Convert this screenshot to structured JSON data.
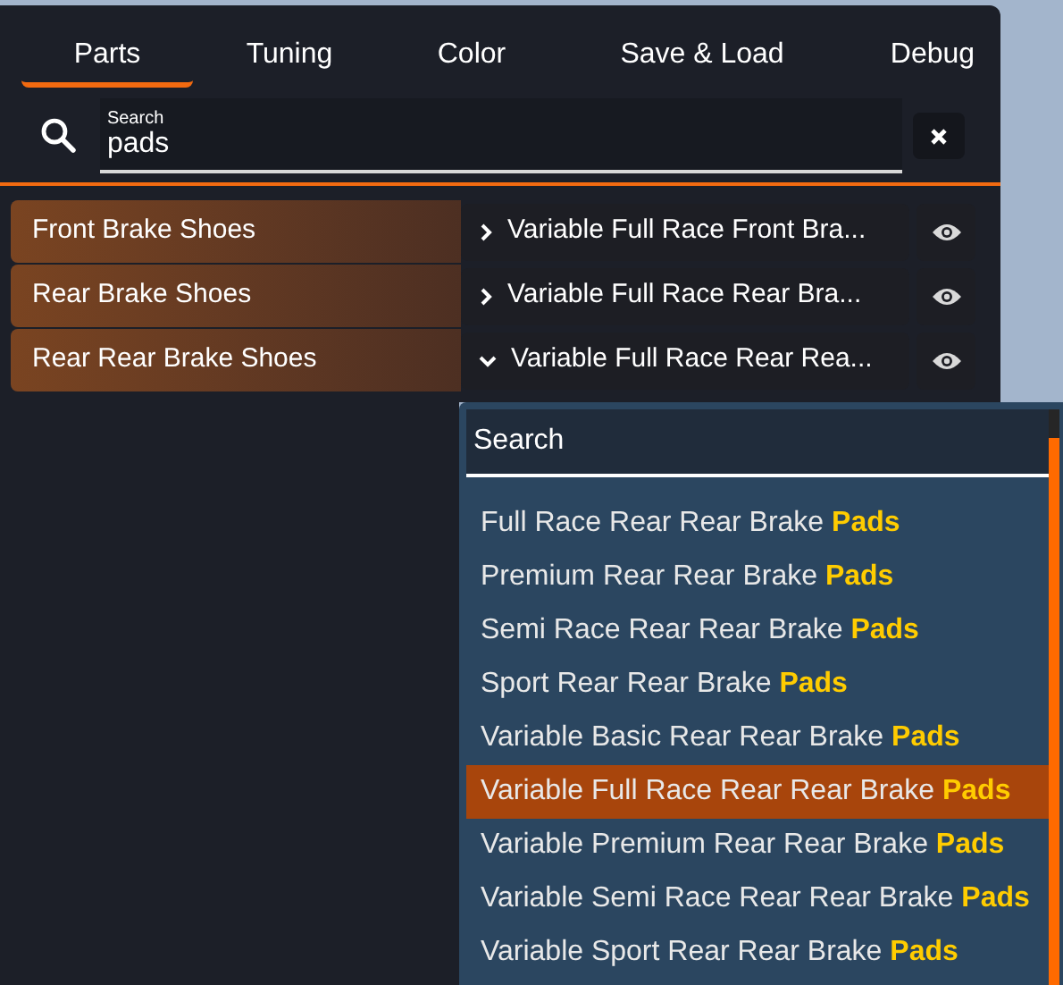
{
  "tabs": [
    {
      "label": "Parts",
      "selected": true
    },
    {
      "label": "Tuning",
      "selected": false
    },
    {
      "label": "Color",
      "selected": false
    },
    {
      "label": "Save & Load",
      "selected": false
    },
    {
      "label": "Debug",
      "selected": false
    }
  ],
  "search": {
    "label": "Search",
    "value": "pads"
  },
  "parts": [
    {
      "slot": "Front Brake Shoes",
      "choice": "Variable Full Race Front Bra...",
      "expanded": false
    },
    {
      "slot": "Rear Brake Shoes",
      "choice": "Variable Full Race Rear Bra...",
      "expanded": false
    },
    {
      "slot": "Rear Rear Brake Shoes",
      "choice": "Variable Full Race Rear Rea...",
      "expanded": true
    }
  ],
  "dropdown": {
    "search_placeholder": "Search",
    "options": [
      {
        "label": "Full Race Rear Rear Brake **Pads**",
        "selected": false
      },
      {
        "label": "Premium Rear Rear Brake **Pads**",
        "selected": false
      },
      {
        "label": "Semi Race Rear Rear Brake **Pads**",
        "selected": false
      },
      {
        "label": "Sport Rear Rear Brake **Pads**",
        "selected": false
      },
      {
        "label": "Variable Basic Rear Rear Brake **Pads**",
        "selected": false
      },
      {
        "label": "Variable Full Race Rear Rear Brake **Pads**",
        "selected": true
      },
      {
        "label": "Variable Premium Rear Rear Brake **Pads**",
        "selected": false
      },
      {
        "label": "Variable Semi Race Rear Rear Brake **Pads**",
        "selected": false
      },
      {
        "label": "Variable Sport Rear Rear Brake **Pads**",
        "selected": false
      }
    ]
  }
}
